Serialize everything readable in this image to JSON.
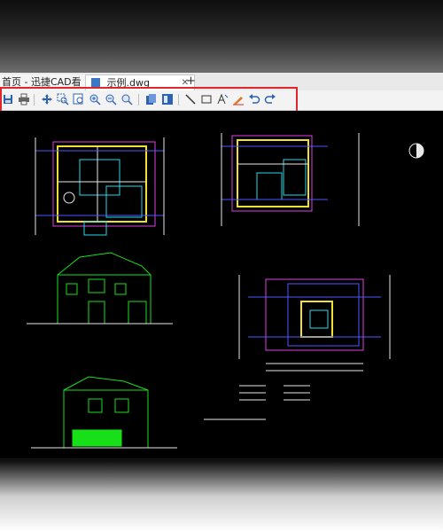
{
  "tabs": [
    {
      "label": "首页 - 迅捷CAD看图"
    },
    {
      "label": "示例.dwg"
    }
  ],
  "new_tab_symbol": "+",
  "close_symbol": "✕",
  "toolbar_icons": [
    "save-icon",
    "print-icon",
    "pan-icon",
    "zoom-window-icon",
    "zoom-extents-icon",
    "zoom-in-icon",
    "zoom-out-icon",
    "zoom-previous-icon",
    "layers-icon",
    "layout-icon",
    "line-measure-icon",
    "rectangle-icon",
    "text-icon",
    "markup-icon",
    "undo-icon",
    "redo-icon"
  ],
  "colors": {
    "highlight": "#e0252c",
    "cad_green": "#18e018",
    "cad_magenta": "#e040e0",
    "cad_cyan": "#29d9e8",
    "cad_yellow": "#f1e033",
    "cad_blue": "#5059ff"
  }
}
